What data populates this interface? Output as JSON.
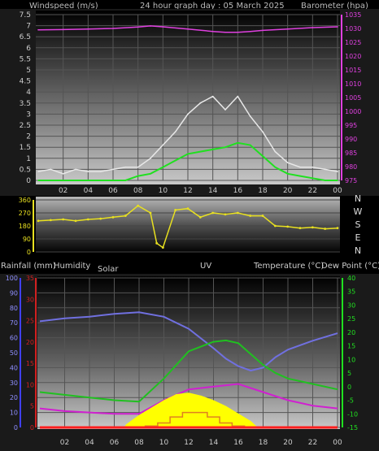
{
  "header": {
    "windspeed_label": "Windspeed (m/s)",
    "title": "24 hour graph day : 05 March 2025",
    "barometer_label": "Barometer (hpa)"
  },
  "panel3_labels": {
    "rainfall": "Rainfall (mm)",
    "humidity": "Humidity",
    "solar": "Solar",
    "uv": "UV",
    "temperature": "Temperature (°C)",
    "dewpoint": "Dew Point (°C)"
  },
  "compass": [
    "N",
    "W",
    "S",
    "E",
    "N"
  ],
  "colors": {
    "pressure": "#e040e0",
    "wind_gust": "#e8e8e8",
    "wind_avg": "#20e020",
    "wind_dir": "#e8e020",
    "humidity": "#7070e0",
    "temperature": "#20c020",
    "dewpoint": "#d020d0",
    "solar": "#ffff00",
    "uv": "#e08020",
    "rain": "#ff2020",
    "rain_axis": "#d02020",
    "humidity_axis": "#4040ff",
    "temp_axis": "#20e020"
  },
  "chart_data": [
    {
      "type": "line",
      "name": "wind-barometer",
      "x_ticks": [
        "02",
        "04",
        "06",
        "08",
        "10",
        "12",
        "14",
        "16",
        "18",
        "20",
        "22",
        "00"
      ],
      "y_left_ticks": [
        "0",
        "0.5",
        "1",
        "1.5",
        "2",
        "2.5",
        "3",
        "3.5",
        "4",
        "4.5",
        "5",
        "5.5",
        "6",
        "6.5",
        "7",
        "7.5"
      ],
      "y_left_range": [
        0,
        7.5
      ],
      "y_right_ticks": [
        "975",
        "980",
        "985",
        "990",
        "995",
        "1000",
        "1005",
        "1010",
        "1015",
        "1020",
        "1025",
        "1030",
        "1035"
      ],
      "y_right_range": [
        975,
        1035
      ],
      "series": [
        {
          "key": "pressure",
          "axis": "right",
          "x": [
            0,
            2,
            4,
            6,
            8,
            9,
            10,
            12,
            14,
            15,
            16,
            17,
            18,
            20,
            22,
            24
          ],
          "values": [
            1029.5,
            1029.6,
            1029.8,
            1030,
            1030.5,
            1030.9,
            1030.6,
            1029.8,
            1028.9,
            1028.6,
            1028.6,
            1028.9,
            1029.3,
            1029.8,
            1030.3,
            1030.6
          ]
        },
        {
          "key": "wind_gust",
          "axis": "left",
          "x": [
            0,
            1,
            2,
            3,
            4,
            5,
            6,
            7,
            8,
            9,
            10,
            11,
            12,
            13,
            14,
            15,
            16,
            17,
            18,
            19,
            20,
            21,
            22,
            23,
            24
          ],
          "values": [
            0.4,
            0.5,
            0.3,
            0.5,
            0.4,
            0.4,
            0.5,
            0.6,
            0.6,
            1.0,
            1.6,
            2.2,
            3.0,
            3.5,
            3.8,
            3.2,
            3.8,
            2.9,
            2.2,
            1.3,
            0.8,
            0.6,
            0.6,
            0.5,
            0.4
          ]
        },
        {
          "key": "wind_avg",
          "axis": "left",
          "x": [
            0,
            2,
            4,
            6,
            7,
            8,
            9,
            10,
            11,
            12,
            13,
            14,
            15,
            16,
            17,
            18,
            19,
            20,
            21,
            22,
            23,
            24
          ],
          "values": [
            0,
            0,
            0,
            0,
            0,
            0.2,
            0.3,
            0.6,
            0.9,
            1.2,
            1.3,
            1.4,
            1.5,
            1.7,
            1.6,
            1.1,
            0.6,
            0.3,
            0.2,
            0.1,
            0,
            0
          ]
        }
      ]
    },
    {
      "type": "scatter",
      "name": "wind-direction",
      "y_ticks": [
        "0",
        "90",
        "180",
        "270",
        "360"
      ],
      "y_range": [
        0,
        360
      ],
      "x": [
        0,
        1,
        2,
        3,
        4,
        5,
        6,
        7,
        8,
        9,
        9.5,
        10,
        11,
        12,
        13,
        14,
        15,
        16,
        17,
        18,
        19,
        20,
        21,
        22,
        23,
        24
      ],
      "values": [
        215,
        220,
        225,
        215,
        225,
        230,
        240,
        250,
        320,
        270,
        60,
        30,
        290,
        300,
        240,
        270,
        260,
        270,
        250,
        250,
        180,
        175,
        165,
        170,
        160,
        165
      ]
    },
    {
      "type": "line",
      "name": "temperature-humidity",
      "y_humidity_ticks": [
        "0",
        "10",
        "20",
        "30",
        "40",
        "50",
        "60",
        "70",
        "80",
        "90",
        "100"
      ],
      "y_humidity_range": [
        0,
        100
      ],
      "y_rain_ticks": [
        "0",
        "5",
        "10",
        "15",
        "20",
        "25",
        "30",
        "35"
      ],
      "y_rain_range": [
        0,
        35
      ],
      "y_temp_ticks": [
        "-15",
        "-10",
        "-5",
        "0",
        "5",
        "10",
        "15",
        "20",
        "25",
        "30",
        "35",
        "40"
      ],
      "y_temp_range": [
        -15,
        40
      ],
      "series": [
        {
          "key": "humidity",
          "axis": "humidity",
          "x": [
            0,
            2,
            4,
            6,
            8,
            10,
            12,
            14,
            15,
            16,
            17,
            18,
            19,
            20,
            22,
            24
          ],
          "values": [
            71,
            73,
            74,
            76,
            77,
            74,
            66,
            53,
            46,
            41,
            38,
            40,
            47,
            52,
            58,
            63
          ]
        },
        {
          "key": "temperature",
          "axis": "temp",
          "x": [
            0,
            2,
            4,
            6,
            8,
            10,
            11,
            12,
            14,
            15,
            16,
            17,
            18,
            19,
            20,
            22,
            24
          ],
          "values": [
            -2,
            -3,
            -4,
            -5,
            -5.5,
            3,
            8,
            13,
            16.5,
            17,
            16,
            12,
            8,
            5,
            3,
            1,
            -1
          ]
        },
        {
          "key": "dewpoint",
          "axis": "temp",
          "x": [
            0,
            2,
            4,
            6,
            8,
            10,
            12,
            14,
            16,
            18,
            20,
            22,
            24
          ],
          "values": [
            -8,
            -9,
            -9.5,
            -10,
            -10,
            -5,
            -1,
            0,
            1,
            -2,
            -5,
            -7,
            -8
          ]
        },
        {
          "key": "solar",
          "axis": "humidity",
          "x": [
            6.8,
            7,
            8,
            9,
            10,
            11,
            12,
            13,
            14,
            15,
            16,
            17,
            17.4,
            17.5
          ],
          "values": [
            0,
            2,
            8,
            13,
            18,
            22,
            23,
            21,
            18,
            14,
            9,
            4,
            1,
            0
          ]
        },
        {
          "key": "uv",
          "axis": "humidity",
          "x": [
            7.5,
            8.5,
            9.5,
            10.5,
            11.5,
            12.5,
            13.5,
            14.5,
            15.5,
            16.5
          ],
          "values": [
            0,
            1,
            3,
            7,
            10,
            10,
            7,
            3,
            1,
            0
          ]
        },
        {
          "key": "rain",
          "axis": "rain",
          "x": [
            0,
            24
          ],
          "values": [
            0,
            0
          ]
        }
      ]
    }
  ]
}
